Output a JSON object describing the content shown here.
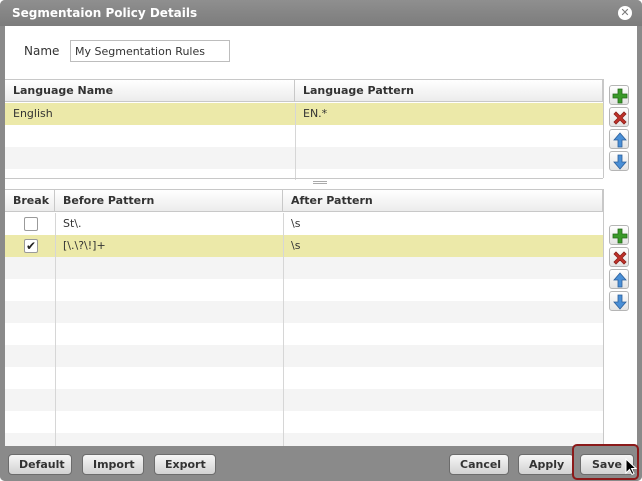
{
  "dialog": {
    "title": "Segmentaion Policy Details"
  },
  "name_field": {
    "label": "Name",
    "value": "My Segmentation Rules"
  },
  "languages": {
    "headers": [
      "Language Name",
      "Language Pattern"
    ],
    "rows": [
      {
        "name": "English",
        "pattern": "EN.*",
        "selected": true
      }
    ]
  },
  "rules": {
    "headers": [
      "Break",
      "Before Pattern",
      "After Pattern"
    ],
    "rows": [
      {
        "break": false,
        "before": "St\\.",
        "after": "\\s",
        "selected": false
      },
      {
        "break": true,
        "before": "[\\.\\?\\!]+",
        "after": "\\s",
        "selected": true
      }
    ]
  },
  "checkmark_glyph": "✔",
  "close_glyph": "✕",
  "icons": {
    "add": "plus-icon",
    "remove": "delete-icon",
    "up": "arrow-up-icon",
    "down": "arrow-down-icon",
    "cursor": "mouse-pointer-icon"
  },
  "footer": {
    "default_label": "Default",
    "import_label": "Import",
    "export_label": "Export",
    "cancel_label": "Cancel",
    "apply_label": "Apply",
    "save_label": "Save"
  },
  "colors": {
    "selected_row": "#ece9a9",
    "frame": "#8a8a8a",
    "add_green": "#3a9a2a",
    "remove_red": "#c0332b",
    "arrow_blue": "#4a8fd6",
    "save_highlight": "#8b1a1a"
  }
}
